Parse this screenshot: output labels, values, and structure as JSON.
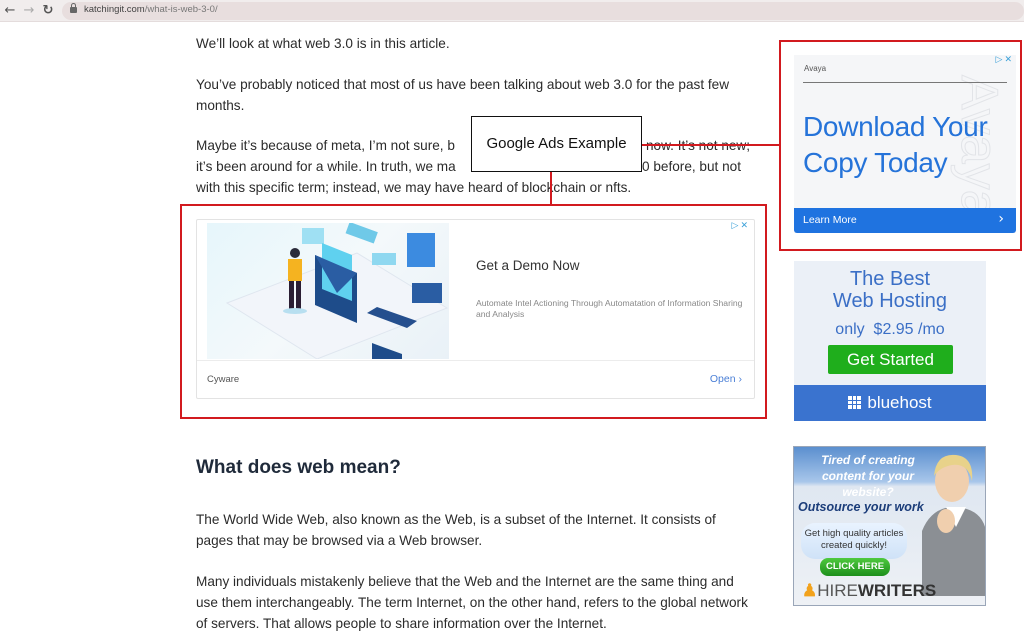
{
  "browser": {
    "back_icon": "arrow-left-icon",
    "forward_icon": "arrow-right-icon",
    "reload_icon": "reload-icon",
    "url_domain": "katchingit.com",
    "url_path": "/what-is-web-3-0/"
  },
  "article": {
    "paragraphs": [
      "We’ll look at what web 3.0 is in this article.",
      "You’ve probably noticed that most of us have been talking about web 3.0 for the past few months.",
      "Maybe it’s because of meta, I’m not sure, b",
      "now. It’s not new;",
      "it’s been around for a while. In truth, we ma",
      "0 before, but not",
      "with this specific term; instead, we may have heard of blockchain or nfts."
    ],
    "heading": "What does web mean?",
    "body": [
      "The World Wide Web, also known as the Web, is a subset of the Internet. It consists of pages that may be browsed via a Web browser.",
      "Many individuals mistakenly believe that the Web and the Internet are the same thing and use them interchangeably. The term Internet, on the other hand, refers to the global network of servers. That allows people to share information over the Internet."
    ]
  },
  "callout": {
    "label": "Google Ads Example",
    "highlight_color": "#d21a1f"
  },
  "inline_ad": {
    "title": "Get a Demo Now",
    "description": "Automate Intel Actioning Through Automatation of Information Sharing and Analysis",
    "advertiser": "Cyware",
    "cta": "Open ›",
    "adchoices": "▷✕"
  },
  "sidebar_ads": {
    "avaya": {
      "brand": "Avaya",
      "watermark": "Avaya",
      "headline": "Download Your Copy Today",
      "cta": "Learn More",
      "cta_arrow": "›",
      "adchoices": "▷✕",
      "accent": "#1f73e0"
    },
    "bluehost": {
      "line1": "The Best",
      "line2": "Web Hosting",
      "price": "only  $2.95 /mo",
      "cta": "Get Started",
      "brand": "bluehost",
      "accent": "#1fae1c"
    },
    "hirewriters": {
      "tagline": "Tired of creating content for your website?",
      "subhead": "Outsource your work",
      "bubble": "Get high quality articles created quickly!",
      "cta": "CLICK HERE",
      "brand_light": "HIRE",
      "brand_bold": "WRITERS"
    }
  }
}
